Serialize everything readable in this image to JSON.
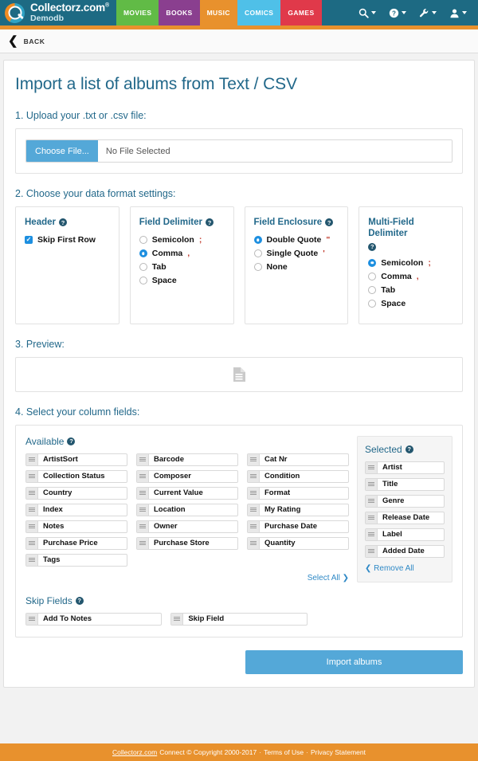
{
  "header": {
    "brand_name": "Collectorz.com",
    "brand_registered": "®",
    "brand_sub": "Demodb",
    "nav_tabs": [
      {
        "label": "MOVIES",
        "color": "#61bb46"
      },
      {
        "label": "BOOKS",
        "color": "#8a3f8f"
      },
      {
        "label": "MUSIC",
        "color": "#e8912d"
      },
      {
        "label": "COMICS",
        "color": "#4fc0e8"
      },
      {
        "label": "GAMES",
        "color": "#e0394a"
      }
    ],
    "icons": [
      "search-icon",
      "help-icon",
      "wrench-icon",
      "user-icon"
    ],
    "bar_color": "#1d6a83",
    "accent_color": "#e8912d"
  },
  "backbar": {
    "label": "BACK"
  },
  "main": {
    "title": "Import a list of albums from Text / CSV",
    "step1": {
      "label": "1. Upload your .txt or .csv file:",
      "choose_button": "Choose File...",
      "file_status": "No File Selected"
    },
    "step2": {
      "label": "2. Choose your data format settings:",
      "boxes": [
        {
          "title": "Header",
          "type": "checkbox",
          "options": [
            {
              "label": "Skip First Row",
              "checked": true,
              "symbol": ""
            }
          ]
        },
        {
          "title": "Field Delimiter",
          "type": "radio",
          "options": [
            {
              "label": "Semicolon",
              "checked": false,
              "symbol": ";"
            },
            {
              "label": "Comma",
              "checked": true,
              "symbol": ","
            },
            {
              "label": "Tab",
              "checked": false,
              "symbol": ""
            },
            {
              "label": "Space",
              "checked": false,
              "symbol": ""
            }
          ]
        },
        {
          "title": "Field Enclosure",
          "type": "radio",
          "options": [
            {
              "label": "Double Quote",
              "checked": true,
              "symbol": "\""
            },
            {
              "label": "Single Quote",
              "checked": false,
              "symbol": "'"
            },
            {
              "label": "None",
              "checked": false,
              "symbol": ""
            }
          ]
        },
        {
          "title": "Multi-Field Delimiter",
          "type": "radio",
          "options": [
            {
              "label": "Semicolon",
              "checked": true,
              "symbol": ";"
            },
            {
              "label": "Comma",
              "checked": false,
              "symbol": ","
            },
            {
              "label": "Tab",
              "checked": false,
              "symbol": ""
            },
            {
              "label": "Space",
              "checked": false,
              "symbol": ""
            }
          ]
        }
      ]
    },
    "step3": {
      "label": "3. Preview:",
      "icon": "document-icon",
      "content": ""
    },
    "step4": {
      "label": "4. Select your column fields:",
      "available_title": "Available",
      "available_columns": [
        [
          "ArtistSort",
          "Collection Status",
          "Country",
          "Index",
          "Notes",
          "Purchase Price",
          "Tags"
        ],
        [
          "Barcode",
          "Composer",
          "Current Value",
          "Location",
          "Owner",
          "Purchase Store"
        ],
        [
          "Cat Nr",
          "Condition",
          "Format",
          "My Rating",
          "Purchase Date",
          "Quantity"
        ]
      ],
      "select_all": "Select All ❯",
      "selected_title": "Selected",
      "selected_items": [
        "Artist",
        "Title",
        "Genre",
        "Release Date",
        "Label",
        "Added Date"
      ],
      "remove_all": "❮ Remove All",
      "skip_title": "Skip Fields",
      "skip_items": [
        "Add To Notes",
        "Skip Field"
      ]
    },
    "import_button": "Import albums"
  },
  "footer": {
    "link": "Collectorz.com",
    "text": "Connect © Copyright 2000-2017",
    "sep1": "·",
    "terms": "Terms of Use",
    "sep2": "·",
    "privacy": "Privacy Statement"
  }
}
